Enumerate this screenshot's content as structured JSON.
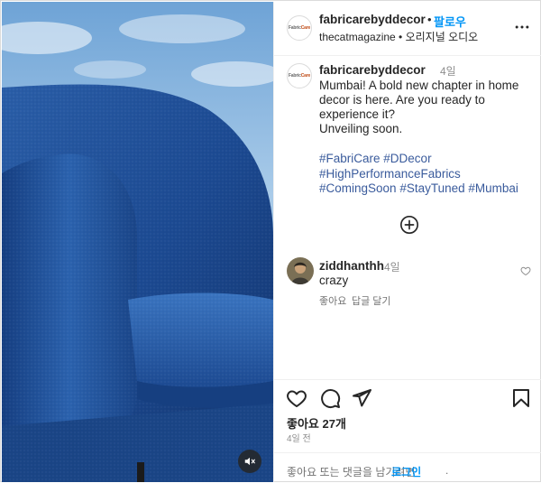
{
  "header": {
    "username": "fabricarebyddecor",
    "separator": "•",
    "follow_label": "팔로우",
    "audio_label": "thecatmagazine • 오리지널 오디오",
    "avatar_logo_main": "Fabric",
    "avatar_logo_accent": "Care"
  },
  "caption": {
    "username": "fabricarebyddecor",
    "time": "4일",
    "lines": [
      "Mumbai! A bold new chapter in home",
      "decor is here. Are you ready to",
      "experience it?",
      "Unveiling soon."
    ],
    "hashtags": {
      "line1_a": "#FabriCare",
      "line1_b": "#DDecor",
      "line2_a": "#HighPerformanceFabrics",
      "line3_a": "#ComingSoon",
      "line3_b": "#StayTuned",
      "line3_c": "#Mumbai"
    }
  },
  "comment": {
    "username": "ziddhanthh",
    "time": "4일",
    "text": "crazy",
    "like_label": "좋아요",
    "reply_label": "답글 달기"
  },
  "actions": {
    "likes_label": "좋아요 27개",
    "date_label": "4일 전"
  },
  "login": {
    "prompt": "좋아요 또는 댓글을 남기려면",
    "link": "로그인",
    "end": "."
  },
  "colors": {
    "link_blue": "#0095f6",
    "hashtag_blue": "#3a5b9c",
    "sofa_blue": "#1f4f9a",
    "sky_blue": "#8fb8e0"
  },
  "icons": {
    "mute": "speaker-muted-icon",
    "more": "more-options-icon",
    "load_more": "plus-circle-icon",
    "like": "heart-icon",
    "comment": "comment-bubble-icon",
    "share": "paper-plane-icon",
    "save": "bookmark-icon"
  }
}
